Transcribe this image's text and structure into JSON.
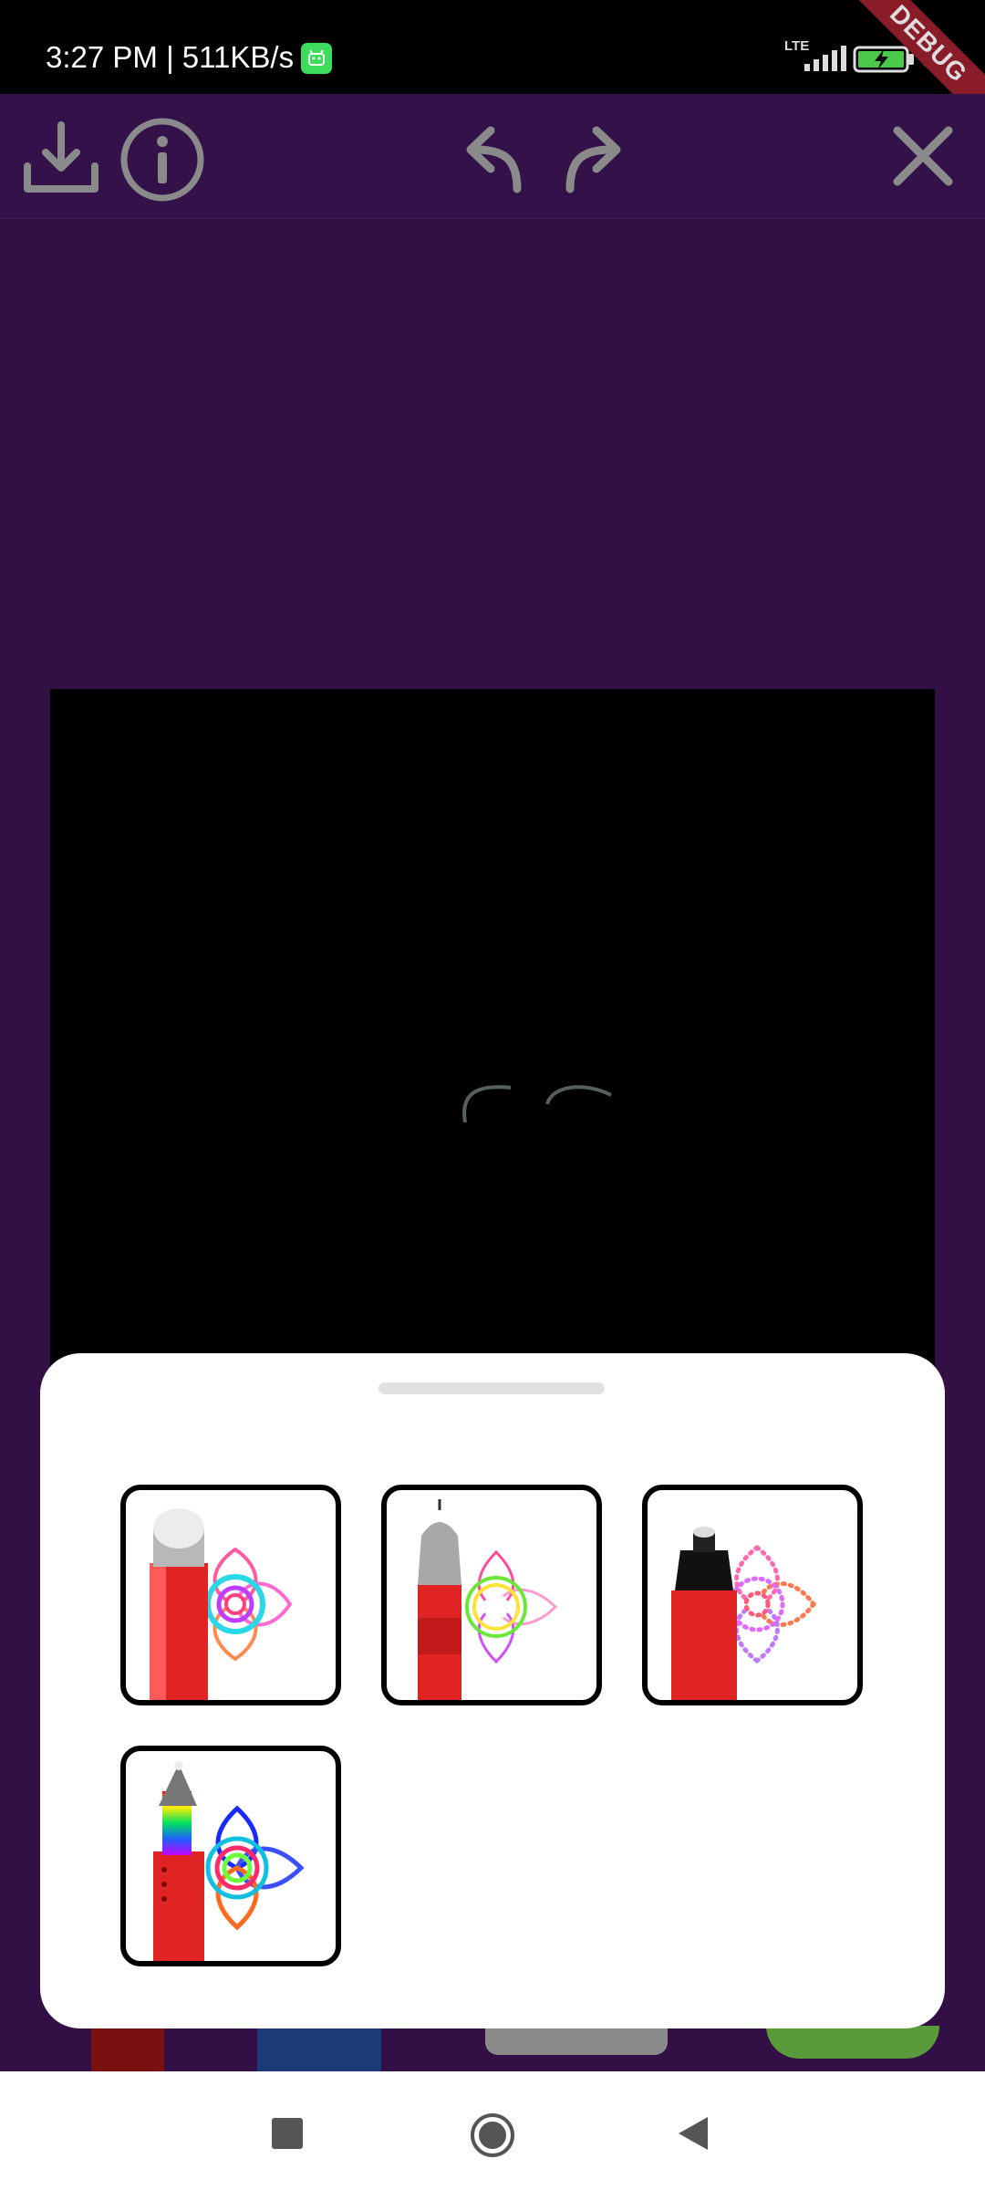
{
  "status_bar": {
    "time_speed": "3:27 PM | 511KB/s",
    "network": "LTE",
    "battery": "94",
    "battery_suffix": "%",
    "debug_label": "DEBUG"
  },
  "toolbar": {
    "icons": [
      "download-icon",
      "info-icon",
      "undo-icon",
      "redo-icon",
      "close-icon"
    ]
  },
  "colors": {
    "app_background": "#321046",
    "toolbar_background": "#331249",
    "toolbar_icon": "#8a8a8a",
    "canvas": "#000000",
    "sheet": "#ffffff"
  },
  "brush_sheet": {
    "options": [
      {
        "id": "glow-marker",
        "icon": "glow-marker-brush-icon"
      },
      {
        "id": "neon-pen",
        "icon": "neon-pen-brush-icon"
      },
      {
        "id": "dotted-marker",
        "icon": "dotted-marker-brush-icon"
      },
      {
        "id": "rainbow-pen",
        "icon": "rainbow-pen-brush-icon"
      }
    ]
  },
  "nav_bar": {
    "icons": [
      "recents-square-icon",
      "home-circle-icon",
      "back-triangle-icon"
    ]
  }
}
